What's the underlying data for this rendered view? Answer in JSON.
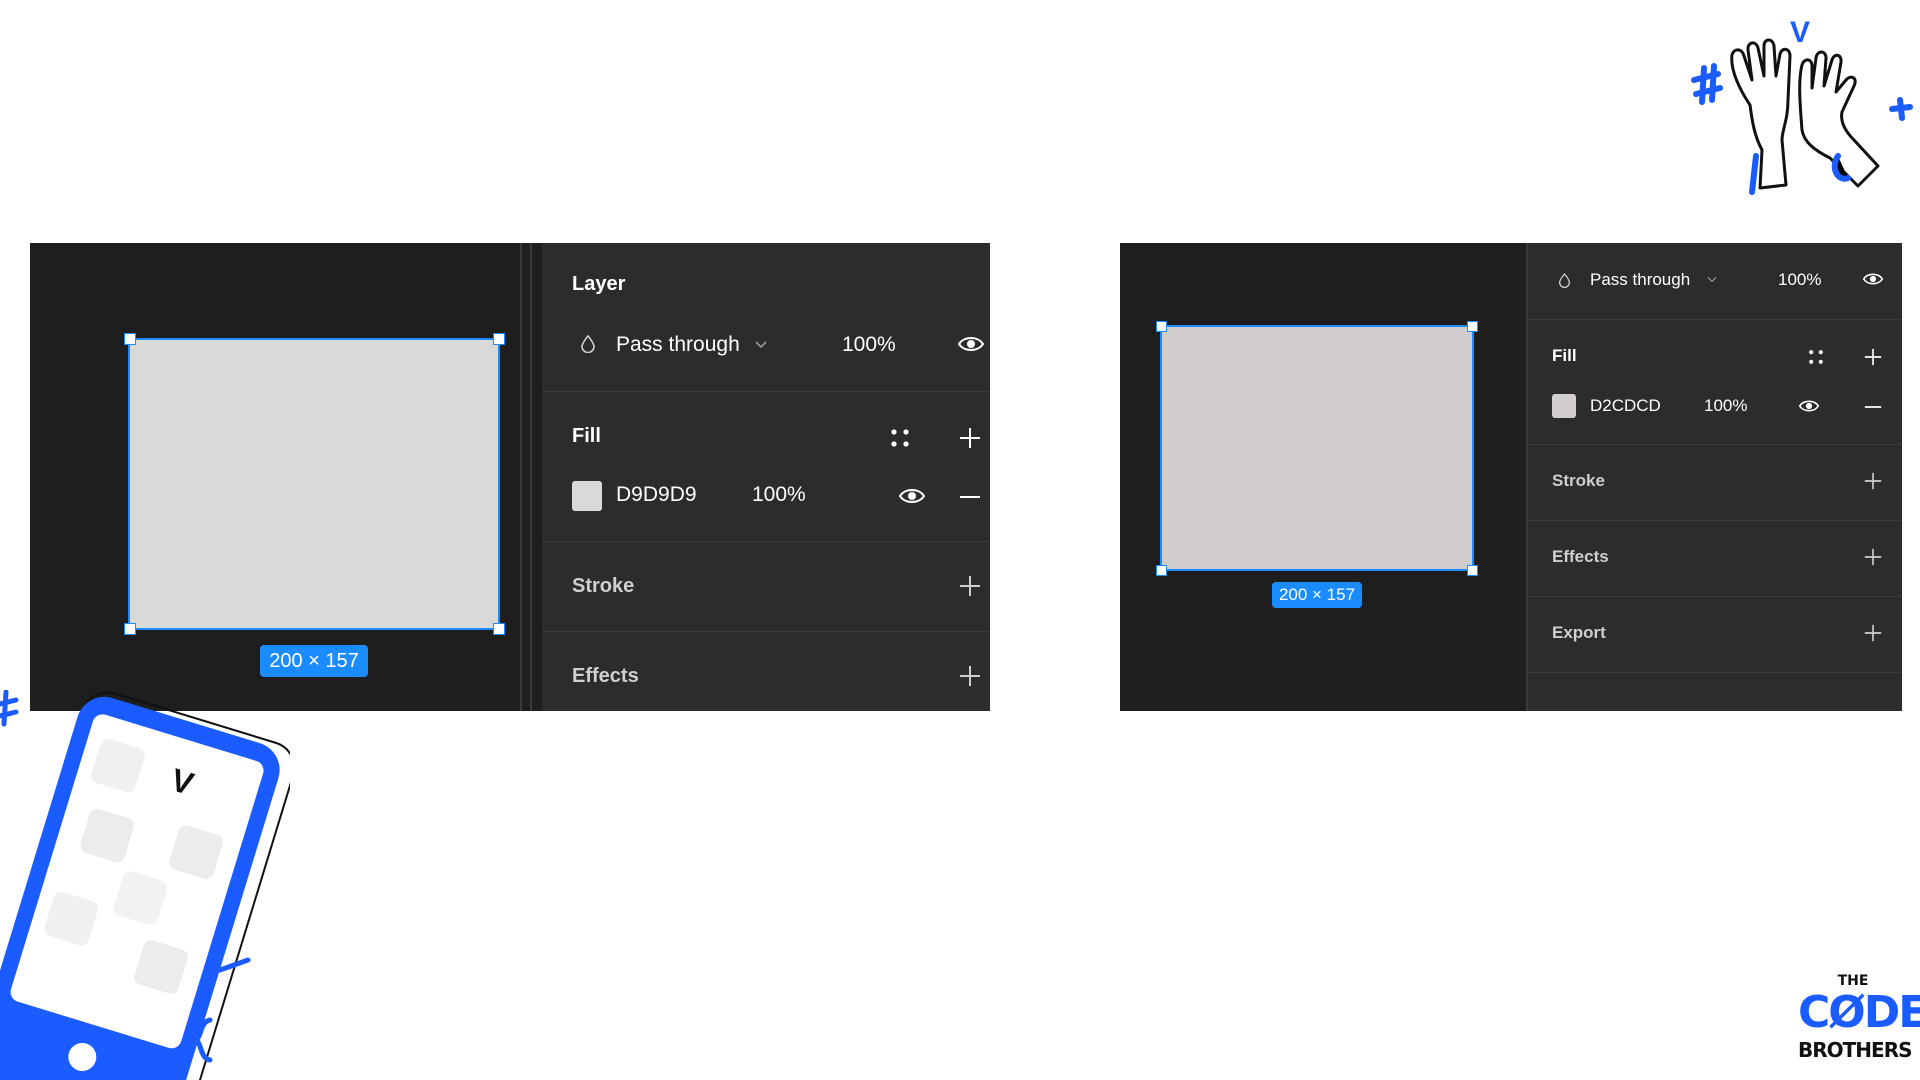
{
  "left": {
    "layer_title": "Layer",
    "blend_mode": "Pass through",
    "layer_opacity": "100%",
    "fill_title": "Fill",
    "fill_hex": "D9D9D9",
    "fill_color": "#D9D9D9",
    "fill_opacity": "100%",
    "stroke_title": "Stroke",
    "effects_title": "Effects",
    "dimensions": "200 × 157"
  },
  "right": {
    "blend_mode": "Pass through",
    "layer_opacity": "100%",
    "fill_title": "Fill",
    "fill_hex": "D2CDCD",
    "fill_color": "#D2CDCD",
    "fill_opacity": "100%",
    "stroke_title": "Stroke",
    "effects_title": "Effects",
    "export_title": "Export",
    "dimensions": "200 × 157"
  },
  "brand": {
    "logo_line1": "THE",
    "logo_line2": "CØDE",
    "logo_line3": "BROTHERS",
    "accent_color": "#1a5cff"
  },
  "decor": {
    "phone_glyph": "V",
    "hands_glyph": "V"
  }
}
